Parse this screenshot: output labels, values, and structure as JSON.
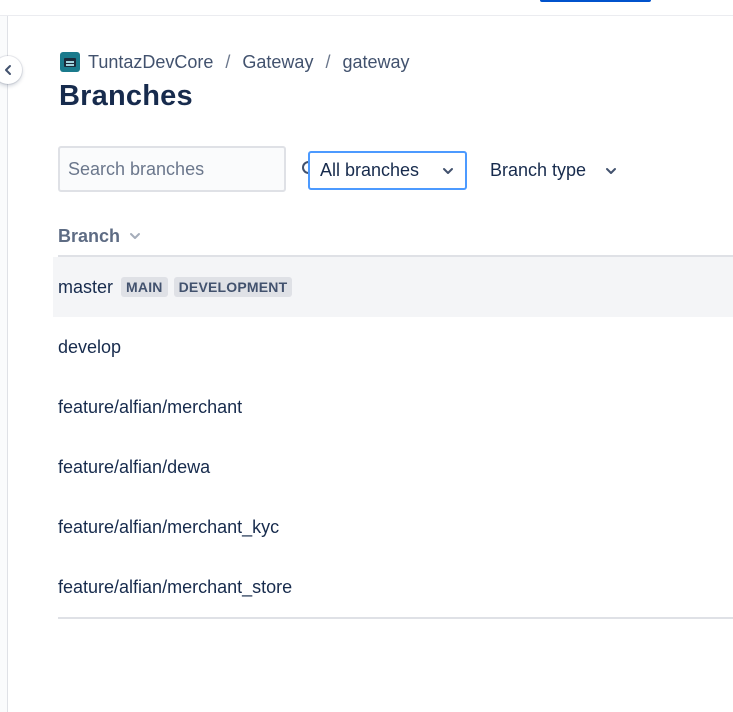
{
  "breadcrumb": {
    "project": "TuntazDevCore",
    "separator": "/",
    "workspace": "Gateway",
    "repo": "gateway"
  },
  "page": {
    "title": "Branches"
  },
  "filters": {
    "search_placeholder": "Search branches",
    "branch_filter": "All branches",
    "branch_type": "Branch type"
  },
  "table": {
    "column_header": "Branch",
    "rows": [
      {
        "name": "master",
        "badges": [
          "MAIN",
          "DEVELOPMENT"
        ]
      },
      {
        "name": "develop"
      },
      {
        "name": "feature/alfian/merchant"
      },
      {
        "name": "feature/alfian/dewa"
      },
      {
        "name": "feature/alfian/merchant_kyc"
      },
      {
        "name": "feature/alfian/merchant_store"
      }
    ]
  },
  "icons": {
    "collapse": "chevron-left-icon",
    "search": "search-icon",
    "dropdown": "chevron-down-icon",
    "repo": "repo-avatar-icon"
  },
  "colors": {
    "text": "#172b4d",
    "secondary": "#42526e",
    "focus_border": "#4c9aff",
    "lozenge_bg": "#dfe1e6",
    "row_hover": "#f4f5f7"
  }
}
